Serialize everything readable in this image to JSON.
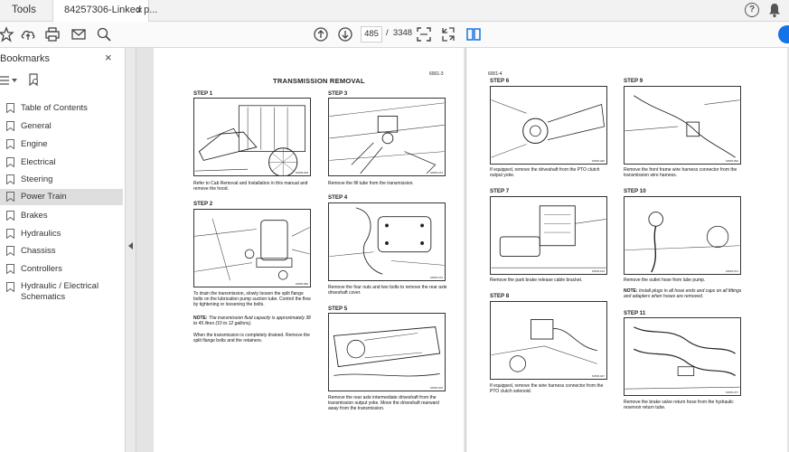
{
  "topbar": {
    "tools_label": "Tools",
    "tab_title": "84257306-Linked p...",
    "tab_close": "×"
  },
  "toolbar": {
    "page_current": "485",
    "page_sep": "/",
    "page_total": "3348"
  },
  "sidebar": {
    "title": "Bookmarks",
    "close": "×",
    "items": [
      {
        "label": "Table of Contents"
      },
      {
        "label": "General"
      },
      {
        "label": "Engine"
      },
      {
        "label": "Electrical"
      },
      {
        "label": "Steering"
      },
      {
        "label": "Power Train"
      },
      {
        "label": "Brakes"
      },
      {
        "label": "Hydraulics"
      },
      {
        "label": "Chassiss"
      },
      {
        "label": "Controllers"
      },
      {
        "label": "Hydraulic / Electrical Schematics"
      }
    ],
    "active_item": "Power Train"
  },
  "doc": {
    "left": {
      "title": "TRANSMISSION REMOVAL",
      "page_no": "6001-3",
      "steps": [
        {
          "label": "STEP 1",
          "code": "MX05-019",
          "caption": "Refer to Cab Removal and Installation in this manual and remove the hood."
        },
        {
          "label": "STEP 2",
          "code": "MX05-060",
          "caption": "To drain the transmission, slowly loosen the split flange bolts on the lubrication pump suction tube. Control the flow by tightening or loosening the bolts.",
          "note_label": "NOTE:",
          "note": "The transmission fluid capacity is approximately 38 to 45 litres (10 to 12 gallons).",
          "caption2": "When the transmission is completely drained. Remove the split flange bolts and the retainers."
        },
        {
          "label": "STEP 3",
          "code": "MX05-274",
          "caption": "Remove the fill tube from the transmission."
        },
        {
          "label": "STEP 4",
          "code": "MX05-273",
          "caption": "Remove the four nuts and two bolts to remove the rear axle driveshaft cover."
        },
        {
          "label": "STEP 5",
          "code": "MX05-076",
          "caption": "Remove the rear axle intermediate driveshaft from the transmission output yoke. Move the driveshaft rearward away from the transmission."
        }
      ]
    },
    "right": {
      "page_no": "6001-4",
      "steps": [
        {
          "label": "STEP 6",
          "code": "MX05-046",
          "caption": "If equipped, remove the driveshaft from the PTO clutch output yoke."
        },
        {
          "label": "STEP 7",
          "code": "MX05-104",
          "caption": "Remove the park brake release cable bracket."
        },
        {
          "label": "STEP 8",
          "code": "MX05-047",
          "caption": "If equipped, remove the wire harness connector from the PTO clutch solenoid."
        },
        {
          "label": "STEP 9",
          "code": "MX05-052",
          "caption": "Remove the front frame wire harness connector from the transmission wire harness."
        },
        {
          "label": "STEP 10",
          "code": "MX05-071",
          "caption": "Remove the outlet hose from lube pump.",
          "note_label": "NOTE:",
          "note": "Install plugs in all hose ends and caps on all fittings and adapters when hoses are removed."
        },
        {
          "label": "STEP 11",
          "code": "MX05-077",
          "caption": "Remove the brake valve return hose from the hydraulic reservoir return tube."
        }
      ]
    }
  }
}
